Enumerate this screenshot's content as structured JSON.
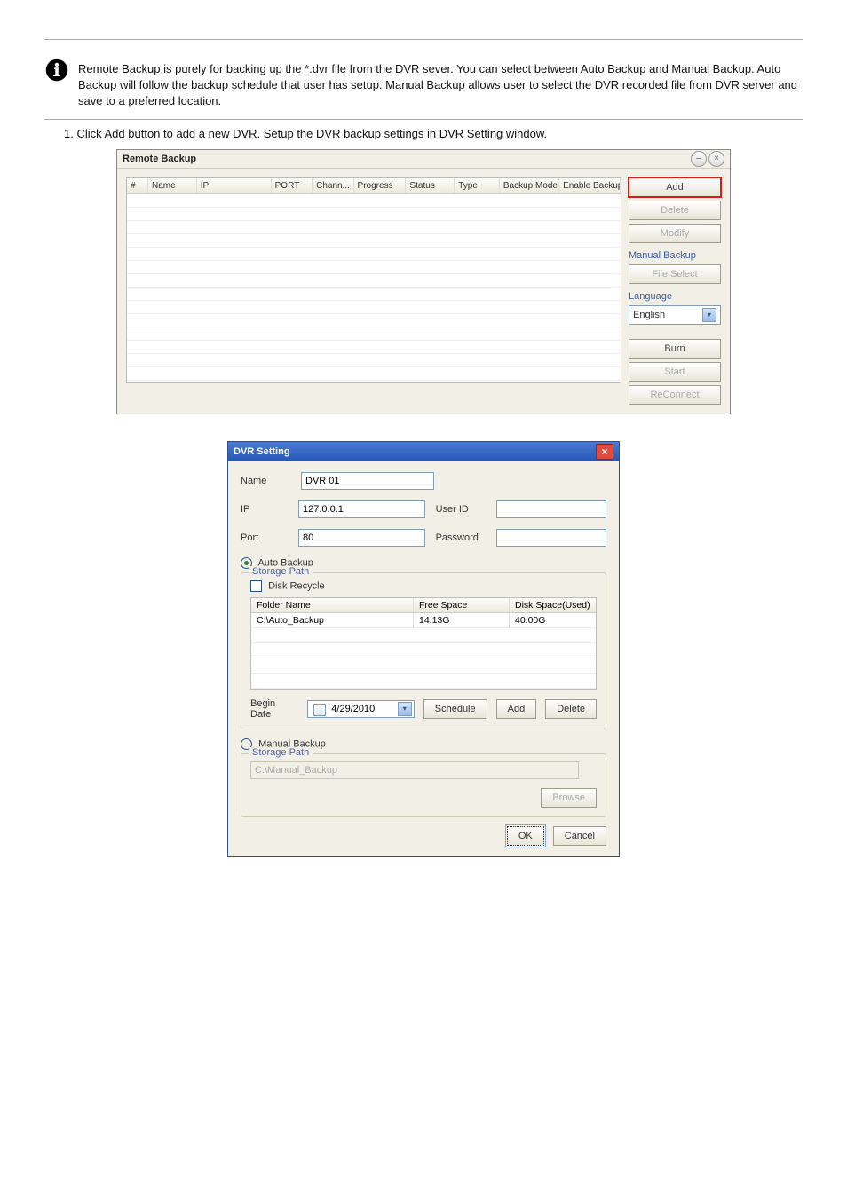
{
  "doc": {
    "note_text": "Remote Backup is purely for backing up the *.dvr file from the DVR sever. You can select between Auto Backup and Manual Backup. Auto Backup will follow the backup schedule that user has setup. Manual Backup allows user to select the DVR recorded file from DVR server and save to a preferred location.",
    "step1": "1. Click Add button to add a new DVR. Setup the DVR backup settings in DVR Setting window."
  },
  "remote_backup": {
    "title": "Remote Backup",
    "columns": [
      "#",
      "Name",
      "IP",
      "PORT",
      "Chann...",
      "Progress",
      "Status",
      "Type",
      "Backup Mode",
      "Enable Backup"
    ],
    "side": {
      "add": "Add",
      "delete": "Delete",
      "modify": "Modify",
      "manual_backup_label": "Manual Backup",
      "file_select": "File Select",
      "language_label": "Language",
      "language_value": "English",
      "burn": "Burn",
      "start": "Start",
      "reconnect": "ReConnect"
    }
  },
  "dvr_setting": {
    "title": "DVR Setting",
    "labels": {
      "name": "Name",
      "ip": "IP",
      "port": "Port",
      "user_id": "User ID",
      "password": "Password",
      "auto_backup": "Auto Backup",
      "storage_path": "Storage Path",
      "disk_recycle": "Disk Recycle",
      "folder_name": "Folder Name",
      "free_space": "Free Space",
      "disk_space_used": "Disk Space(Used)",
      "begin_date": "Begin Date",
      "schedule": "Schedule",
      "add": "Add",
      "delete": "Delete",
      "manual_backup": "Manual Backup",
      "browse": "Browse",
      "ok": "OK",
      "cancel": "Cancel"
    },
    "values": {
      "name": "DVR 01",
      "ip": "127.0.0.1",
      "port": "80",
      "user_id": "",
      "password": "",
      "date": "4/29/2010",
      "manual_path": "C:\\Manual_Backup"
    },
    "storage_rows": [
      {
        "folder": "C:\\Auto_Backup",
        "free": "14.13G",
        "used": "40.00G"
      }
    ]
  }
}
